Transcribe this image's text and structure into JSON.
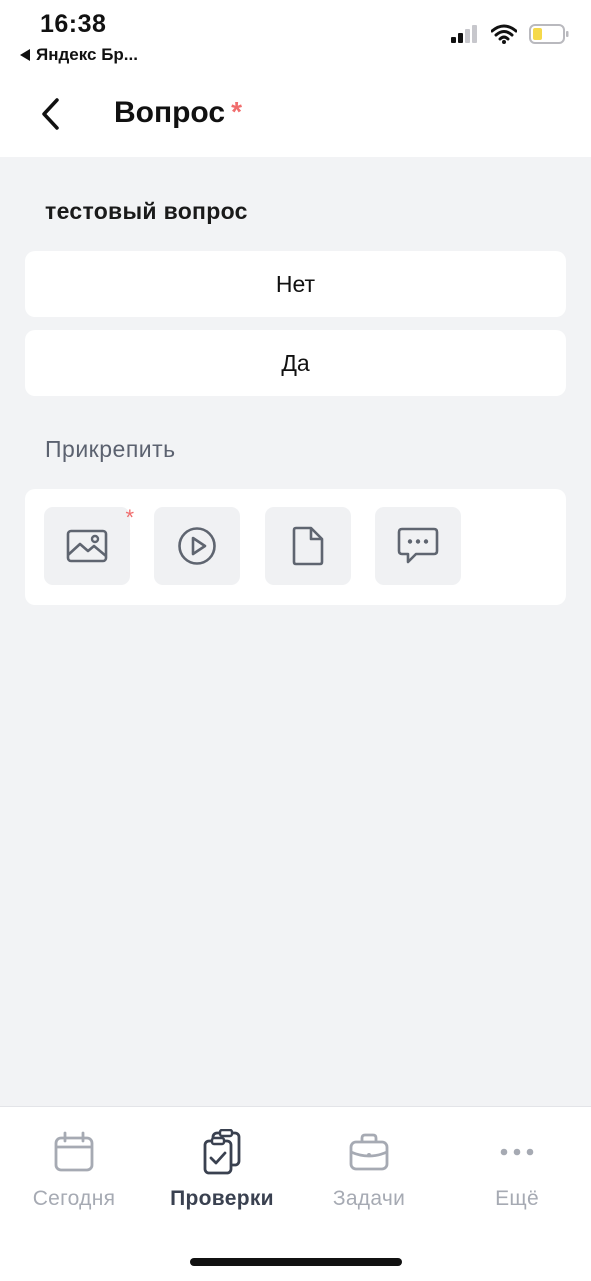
{
  "status_bar": {
    "time": "16:38",
    "back_app": "Яндекс Бр...",
    "icons": [
      "cellular-signal-icon",
      "wifi-icon",
      "battery-icon"
    ]
  },
  "header": {
    "title": "Вопрос",
    "required_mark": "*",
    "back_icon": "chevron-left-icon"
  },
  "question": {
    "text": "тестовый вопрос",
    "answers": [
      "Нет",
      "Да"
    ]
  },
  "attach": {
    "label": "Прикрепить",
    "required_mark": "*",
    "options": [
      "image-icon",
      "video-play-icon",
      "document-icon",
      "comment-icon"
    ]
  },
  "tabs": [
    {
      "label": "Сегодня",
      "icon": "calendar-icon",
      "active": false
    },
    {
      "label": "Проверки",
      "icon": "checklist-icon",
      "active": true
    },
    {
      "label": "Задачи",
      "icon": "briefcase-icon",
      "active": false
    },
    {
      "label": "Ещё",
      "icon": "more-icon",
      "active": false
    }
  ],
  "colors": {
    "background": "#f2f3f5",
    "required": "#f06d6d",
    "tab_active": "#3a4150",
    "tab_inactive": "#a6aab3"
  }
}
